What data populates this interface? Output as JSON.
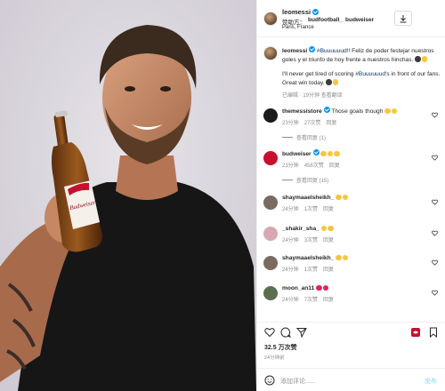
{
  "post": {
    "username": "leomessi",
    "sponsor_prefix": "赞助方：",
    "sponsor_brand": "budfootball_",
    "sponsor_partner": "budweiser",
    "location": "Paris, France",
    "bottle_label": "Budweiser"
  },
  "caption": {
    "username": "leomessi",
    "hashtag1": "#Buuuuuud",
    "text_es": "!! Feliz de poder festejar nuestros goles y el triunfo de hoy frente a nuestros hinchas.",
    "text_en_1": "I'll never get tired of scoring ",
    "hashtag2": "#Buuuuuud",
    "text_en_2": "'s in front of our fans. Great win today.",
    "meta_edited": "已编辑",
    "meta_time": "19分钟"
  },
  "comments": [
    {
      "username": "themessistore",
      "text": "Those goals though",
      "emoji": [
        "e-yellow",
        "e-yellow"
      ],
      "time": "23分钟",
      "likes": "27次赞",
      "reply": "回复",
      "replies": "查看回复 (1)",
      "avatar_color": "#1b1b1b",
      "heart": true
    },
    {
      "username": "budweiser",
      "text": "",
      "emoji": [
        "e-yellow",
        "e-yellow",
        "e-yellow"
      ],
      "time": "23分钟",
      "likes": "458次赞",
      "reply": "回复",
      "replies": "查看回复 (15)",
      "avatar_color": "#c8102e",
      "heart": true
    },
    {
      "username": "shaymaaelsheikh_",
      "text": "",
      "emoji": [
        "e-yellow",
        "e-yellow"
      ],
      "time": "24分钟",
      "likes": "1次赞",
      "reply": "回复",
      "replies": "",
      "avatar_color": "#7b6a60",
      "heart": true
    },
    {
      "username": "_shakir_sha_",
      "text": "",
      "emoji": [
        "e-yellow",
        "e-yellow"
      ],
      "time": "24分钟",
      "likes": "3次赞",
      "reply": "回复",
      "replies": "",
      "avatar_color": "#d8a7b1",
      "heart": true
    },
    {
      "username": "shaymaaelsheikh_",
      "text": "",
      "emoji": [
        "e-yellow",
        "e-yellow"
      ],
      "time": "24分钟",
      "likes": "1次赞",
      "reply": "回复",
      "replies": "",
      "avatar_color": "#7b6a60",
      "heart": true
    },
    {
      "username": "moon_an11",
      "text": "",
      "emoji": [
        "e-red",
        "e-red"
      ],
      "time": "24分钟",
      "likes": "7次赞",
      "reply": "回复",
      "replies": "",
      "avatar_color": "#5b6f4e",
      "heart": true
    }
  ],
  "footer": {
    "likes": "32.5 万次赞",
    "date": "24分钟前",
    "add_comment_placeholder": "添加评论......",
    "post_label": "发布"
  },
  "colors": {
    "link": "#00376b",
    "verified": "#0095f6",
    "muted": "#8e8e8e",
    "liked_red": "#ed4956"
  }
}
